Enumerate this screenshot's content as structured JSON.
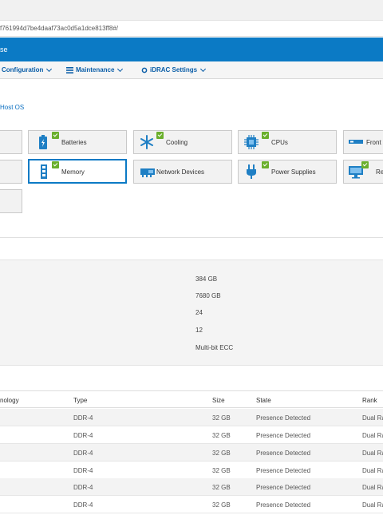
{
  "browser": {
    "url_fragment": "f761994d7be4daaf73ac0d5a1dce813ff8#/"
  },
  "header": {
    "title_fragment": "se"
  },
  "menu": {
    "items": [
      {
        "label": "Configuration"
      },
      {
        "label": "Maintenance"
      },
      {
        "label": "iDRAC Settings"
      }
    ]
  },
  "breadcrumb": {
    "text": "Host OS"
  },
  "tiles": [
    {
      "label": "Batteries",
      "icon": "battery-icon",
      "checked": true
    },
    {
      "label": "Cooling",
      "icon": "snowflake-icon",
      "checked": true
    },
    {
      "label": "CPUs",
      "icon": "cpu-icon",
      "checked": true
    },
    {
      "label": "Front",
      "icon": "front-panel-icon",
      "checked": false
    },
    {
      "label": "Memory",
      "icon": "memory-icon",
      "checked": true,
      "selected": true
    },
    {
      "label": "Network Devices",
      "icon": "network-card-icon",
      "checked": false
    },
    {
      "label": "Power Supplies",
      "icon": "power-plug-icon",
      "checked": true
    },
    {
      "label": "Re",
      "icon": "monitor-icon",
      "checked": true
    }
  ],
  "summary": {
    "values": [
      "384 GB",
      "7680 GB",
      "24",
      "12",
      "Multi-bit ECC"
    ]
  },
  "table": {
    "headers": {
      "technology": "nology",
      "type": "Type",
      "size": "Size",
      "state": "State",
      "rank": "Rank"
    },
    "rows": [
      {
        "type": "DDR-4",
        "size": "32 GB",
        "state": "Presence Detected",
        "rank": "Dual Ra"
      },
      {
        "type": "DDR-4",
        "size": "32 GB",
        "state": "Presence Detected",
        "rank": "Dual Ra"
      },
      {
        "type": "DDR-4",
        "size": "32 GB",
        "state": "Presence Detected",
        "rank": "Dual Ra"
      },
      {
        "type": "DDR-4",
        "size": "32 GB",
        "state": "Presence Detected",
        "rank": "Dual Ra"
      },
      {
        "type": "DDR-4",
        "size": "32 GB",
        "state": "Presence Detected",
        "rank": "Dual Ra"
      },
      {
        "type": "DDR-4",
        "size": "32 GB",
        "state": "Presence Detected",
        "rank": "Dual Ra"
      }
    ]
  },
  "colors": {
    "brand_blue": "#0b7ac5",
    "link_blue": "#0b5ea8",
    "check_green": "#6aaf2c"
  }
}
